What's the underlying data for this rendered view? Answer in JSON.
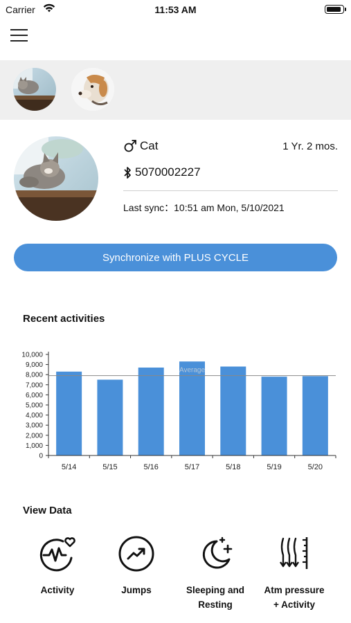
{
  "status_bar": {
    "carrier": "Carrier",
    "time": "11:53 AM"
  },
  "pet": {
    "name": "Cat",
    "sex_icon": "male-icon",
    "age": "1 Yr. 2 mos.",
    "device_id": "5070002227",
    "last_sync_label": "Last sync：",
    "last_sync_value": "10:51 am Mon, 5/10/2021"
  },
  "pets_strip": [
    {
      "name": "cat-avatar"
    },
    {
      "name": "dog-avatar"
    }
  ],
  "sync_button": {
    "label": "Synchronize with PLUS CYCLE",
    "color": "#4a90d9"
  },
  "recent_activities": {
    "title": "Recent activities"
  },
  "chart_data": {
    "type": "bar",
    "categories": [
      "5/14",
      "5/15",
      "5/16",
      "5/17",
      "5/18",
      "5/19",
      "5/20"
    ],
    "values": [
      8300,
      7500,
      8700,
      9300,
      8800,
      7800,
      7850
    ],
    "ylim": [
      0,
      10000
    ],
    "yticks": [
      "0",
      "1,000",
      "2,000",
      "3,000",
      "4,000",
      "5,000",
      "6,000",
      "7,000",
      "8,000",
      "9,000",
      "10,000"
    ],
    "average": {
      "label": "Average",
      "value": 7900
    },
    "bar_color": "#4a90d9",
    "grid": false
  },
  "view_data": {
    "title": "View Data",
    "items": [
      {
        "label": "Activity",
        "icon": "heart-activity-icon"
      },
      {
        "label": "Jumps",
        "icon": "jumps-trend-icon"
      },
      {
        "label": "Sleeping and\nResting",
        "icon": "moon-sleep-icon"
      },
      {
        "label": "Atm pressure\n+ Activity",
        "icon": "pressure-gauge-icon"
      }
    ]
  }
}
